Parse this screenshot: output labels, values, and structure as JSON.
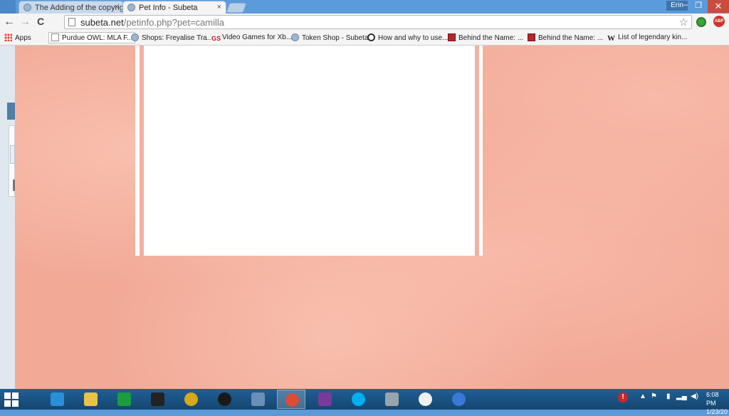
{
  "browser": {
    "tabs": [
      {
        "title": "The Adding of the copyrig",
        "close": "×",
        "active": false
      },
      {
        "title": "Pet Info - Subeta",
        "close": "×",
        "active": true
      }
    ],
    "user": "Erin",
    "window_controls": {
      "minimize": "–",
      "restore": "❐",
      "close": "✕"
    },
    "url_host": "subeta.net",
    "url_path": "/petinfo.php?pet=camilla",
    "nav": {
      "back": "←",
      "forward": "→",
      "reload": "C"
    },
    "star": "☆",
    "extension_badge": "ABP"
  },
  "bookmarks": [
    {
      "label": "Apps",
      "icon": "apps-grid-icon"
    },
    {
      "label": "Purdue OWL: MLA F...",
      "icon": "page-icon"
    },
    {
      "label": "Shops: Freyalise Tra...",
      "icon": "subeta-icon"
    },
    {
      "label": "Video Games for Xb...",
      "icon": "gs-icon"
    },
    {
      "label": "Token Shop - Subeta",
      "icon": "subeta-icon"
    },
    {
      "label": "How and why to use...",
      "icon": "face-icon"
    },
    {
      "label": "Behind the Name: ...",
      "icon": "btn-icon"
    },
    {
      "label": "Behind the Name: ...",
      "icon": "btn-icon"
    },
    {
      "label": "List of legendary kin...",
      "icon": "wikipedia-icon"
    }
  ],
  "taskbar": {
    "clock_time": "6:08 PM",
    "clock_date": "1/23/20",
    "apps": [
      {
        "name": "internet-explorer-icon",
        "color": "#2a8fd8"
      },
      {
        "name": "file-explorer-icon",
        "color": "#e8c24a"
      },
      {
        "name": "store-icon",
        "color": "#1c9c3e"
      },
      {
        "name": "photo-app-icon",
        "color": "#222222"
      },
      {
        "name": "media-player-icon",
        "color": "#d8a81a"
      },
      {
        "name": "hp-icon",
        "color": "#1a1a1a"
      },
      {
        "name": "paint-icon",
        "color": "#6a8fb8"
      },
      {
        "name": "chrome-icon",
        "color": "#dd4b39"
      },
      {
        "name": "remote-icon",
        "color": "#7a3a9a"
      },
      {
        "name": "skype-icon",
        "color": "#00aff0"
      },
      {
        "name": "keyboard-icon",
        "color": "#9aa4ad"
      },
      {
        "name": "penguin-icon",
        "color": "#f0f0f0"
      },
      {
        "name": "download-icon",
        "color": "#3a78d8"
      }
    ]
  },
  "colors": {
    "page_background": "#f2a996",
    "content_background": "#ffffff",
    "taskbar": "#1f5f96"
  }
}
